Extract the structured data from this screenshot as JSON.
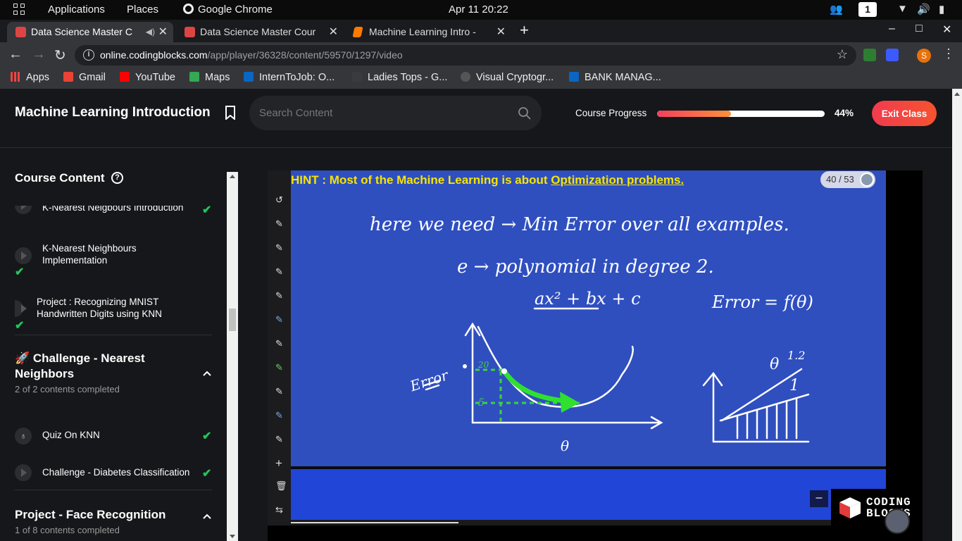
{
  "os_bar": {
    "menus": [
      "Applications",
      "Places",
      "Google Chrome"
    ],
    "clock": "Apr 11  20:22",
    "workspace": "1"
  },
  "tabs": [
    {
      "title": "Data Science Master C",
      "icon": "coding-blocks-favicon",
      "active": true
    },
    {
      "title": "Data Science Master Cour",
      "icon": "coding-blocks-favicon",
      "active": false
    },
    {
      "title": "Machine Learning Intro -",
      "icon": "book-favicon",
      "active": false
    }
  ],
  "address_bar": {
    "host": "online.codingblocks.com",
    "path": "/app/player/36328/content/59570/1297/video"
  },
  "profile_initial": "S",
  "bookmarks": [
    {
      "label": "Apps",
      "icon": "apps-grid-icon",
      "color": "#e44"
    },
    {
      "label": "Gmail",
      "icon": "gmail-icon",
      "color": "#ea4335"
    },
    {
      "label": "YouTube",
      "icon": "youtube-icon",
      "color": "#ff0000"
    },
    {
      "label": "Maps",
      "icon": "maps-icon",
      "color": "#34a853"
    },
    {
      "label": "InternToJob: O...",
      "icon": "linkedin-icon",
      "color": "#0a66c2"
    },
    {
      "label": "Ladies Tops - G...",
      "icon": "page-icon",
      "color": "#35363a"
    },
    {
      "label": "Visual Cryptogr...",
      "icon": "github-icon",
      "color": "#444"
    },
    {
      "label": "BANK MANAG...",
      "icon": "linkedin-icon",
      "color": "#0a66c2"
    }
  ],
  "header": {
    "course_title": "Machine Learning Introduction",
    "search_placeholder": "Search Content",
    "progress_label": "Course Progress",
    "progress_value": 0.44,
    "progress_text": "44%",
    "exit_label": "Exit Class"
  },
  "sidebar": {
    "title": "Course Content",
    "items_top": [
      {
        "label": "K-Nearest Neigbours Introduction",
        "done": true
      },
      {
        "label": "K-Nearest Neighbours Implementation",
        "done": true
      },
      {
        "label": "Project : Recognizing MNIST Handwritten Digits using KNN",
        "done": true
      }
    ],
    "section_challenge": {
      "title": "🚀 Challenge - Nearest Neighbors",
      "subtitle": "2 of 2 contents completed",
      "items": [
        {
          "label": "Quiz On KNN",
          "type": "quiz",
          "done": true
        },
        {
          "label": "Challenge - Diabetes Classification",
          "type": "video",
          "done": true
        }
      ]
    },
    "section_project": {
      "title": "Project - Face Recognition",
      "subtitle": "1 of 8 contents completed"
    }
  },
  "video": {
    "hint_prefix": "HINT : Most of the Machine Learning is about ",
    "hint_underlined": "Optimization problems.",
    "page_counter": "40 / 53",
    "handwriting": {
      "line1": "here we need → Min Error over all examples.",
      "line2": "e → polynomial in degree 2.",
      "poly": "ax² + bx + c",
      "error_fn": "Error = f(θ)",
      "axis_y": "Error",
      "mark_20": "20",
      "mark_5": "5",
      "axis_x": "θ",
      "theta_label": "θ",
      "val_12": "1.2",
      "val_1": "1"
    },
    "logo_text_1": "CODING",
    "logo_text_2": "BLOCKS"
  }
}
